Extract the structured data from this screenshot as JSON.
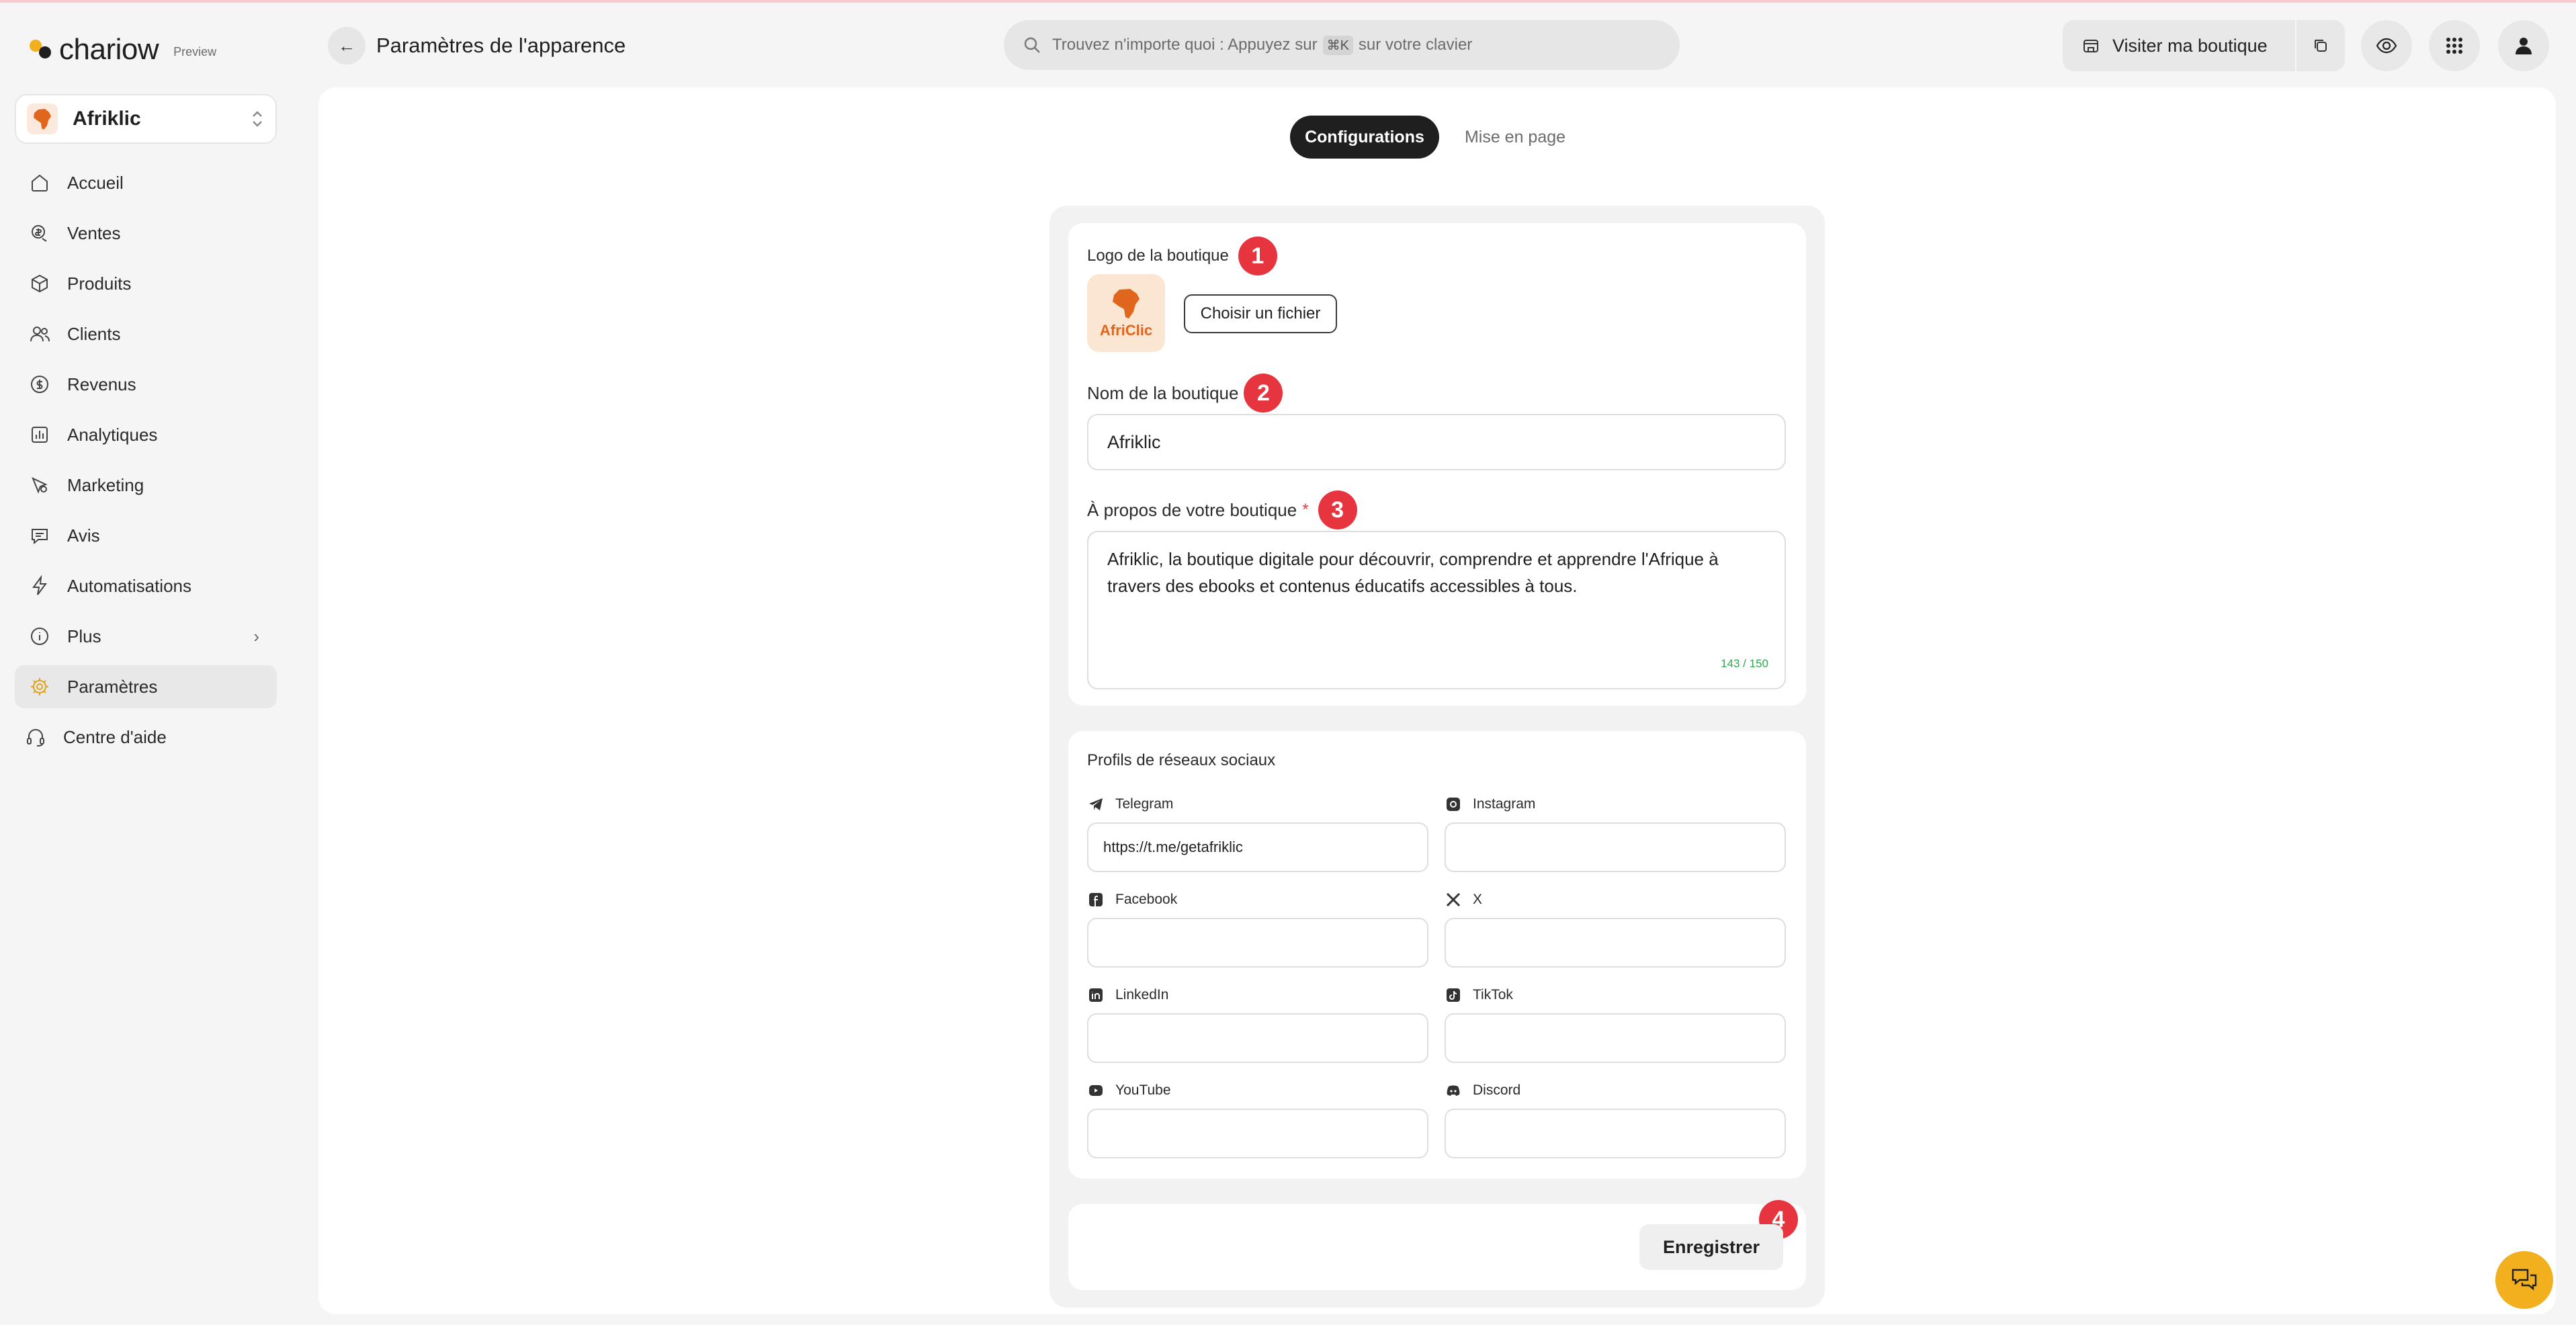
{
  "app": {
    "brand": "chariow",
    "brand_tag": "Preview",
    "store_name": "Afriklic"
  },
  "sidebar": {
    "items": [
      {
        "label": "Accueil",
        "icon": "home-icon"
      },
      {
        "label": "Ventes",
        "icon": "sales-coin-icon"
      },
      {
        "label": "Produits",
        "icon": "box-icon"
      },
      {
        "label": "Clients",
        "icon": "users-icon"
      },
      {
        "label": "Revenus",
        "icon": "dollar-circle-icon"
      },
      {
        "label": "Analytiques",
        "icon": "chart-icon"
      },
      {
        "label": "Marketing",
        "icon": "marketing-icon"
      },
      {
        "label": "Avis",
        "icon": "chat-icon"
      },
      {
        "label": "Automatisations",
        "icon": "lightning-icon"
      },
      {
        "label": "Plus",
        "icon": "info-circle-icon"
      },
      {
        "label": "Paramètres",
        "icon": "gear-icon",
        "active": true
      },
      {
        "label": "Centre d'aide",
        "icon": "headset-icon"
      }
    ]
  },
  "header": {
    "title": "Paramètres de l'apparence",
    "search_prefix": "Trouvez n'importe quoi : Appuyez sur",
    "search_kbd": "⌘K",
    "search_suffix": "sur votre clavier",
    "visit_label": "Visiter ma boutique"
  },
  "tabs": [
    {
      "label": "Configurations",
      "active": true
    },
    {
      "label": "Mise en page",
      "active": false
    }
  ],
  "form": {
    "logo_label": "Logo de la boutique",
    "logo_text": "AfriClic",
    "choose_file": "Choisir un fichier",
    "name_label": "Nom de la boutique",
    "name_value": "Afriklic",
    "about_label": "À propos de votre boutique",
    "required_mark": "*",
    "about_value": "Afriklic, la boutique digitale pour découvrir, comprendre et apprendre l'Afrique à travers des ebooks et contenus éducatifs accessibles à tous.",
    "about_counter": "143 / 150",
    "social_title": "Profils de réseaux sociaux",
    "social": [
      {
        "label": "Telegram",
        "value": "https://t.me/getafriklic",
        "icon": "telegram-icon"
      },
      {
        "label": "Instagram",
        "value": "",
        "icon": "instagram-icon"
      },
      {
        "label": "Facebook",
        "value": "",
        "icon": "facebook-icon"
      },
      {
        "label": "X",
        "value": "",
        "icon": "x-icon"
      },
      {
        "label": "LinkedIn",
        "value": "",
        "icon": "linkedin-icon"
      },
      {
        "label": "TikTok",
        "value": "",
        "icon": "tiktok-icon"
      },
      {
        "label": "YouTube",
        "value": "",
        "icon": "youtube-icon"
      },
      {
        "label": "Discord",
        "value": "",
        "icon": "discord-icon"
      }
    ],
    "save_label": "Enregistrer"
  },
  "annotations": [
    "1",
    "2",
    "3",
    "4"
  ],
  "colors": {
    "accent": "#f2b01e",
    "badge": "#e7353f",
    "primary_tab": "#1f1f1f",
    "counter": "#2fa84f"
  }
}
